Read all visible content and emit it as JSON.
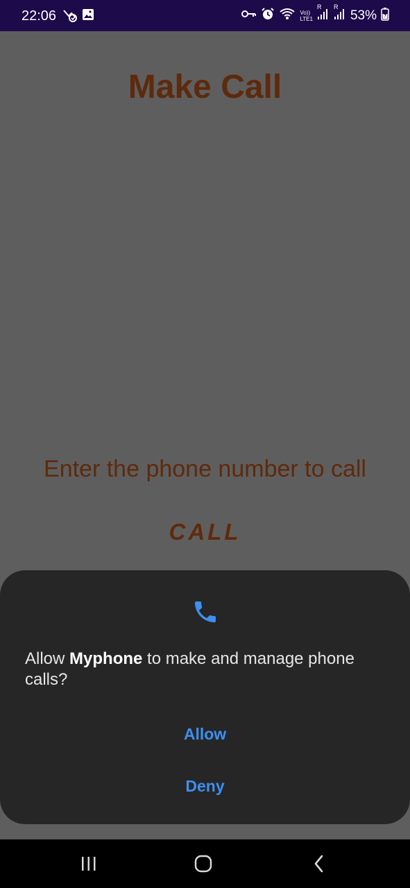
{
  "status_bar": {
    "time": "22:06",
    "battery_percent": "53%",
    "left_icons": [
      "missed-call-icon",
      "gallery-icon"
    ],
    "right_icons": [
      "vpn-key-icon",
      "alarm-icon",
      "wifi-icon",
      "volte-icon",
      "signal-icon",
      "signal-icon",
      "battery-charging-icon"
    ],
    "volte_label": "Vo))",
    "lte_label": "LTE1",
    "roaming_label": "R"
  },
  "app": {
    "title": "Make Call",
    "phone_input": {
      "value": "",
      "placeholder": "Enter the phone number to call"
    },
    "call_button_label": "CALL",
    "text_color": "#5e2a0c"
  },
  "permission_dialog": {
    "icon": "phone-icon",
    "message_prefix": "Allow ",
    "app_name": "Myphone",
    "message_suffix": " to make and manage phone calls?",
    "allow_label": "Allow",
    "deny_label": "Deny",
    "accent_color": "#3d8ff0"
  },
  "nav_bar": {
    "buttons": [
      "recents-icon",
      "home-icon",
      "back-icon"
    ]
  }
}
